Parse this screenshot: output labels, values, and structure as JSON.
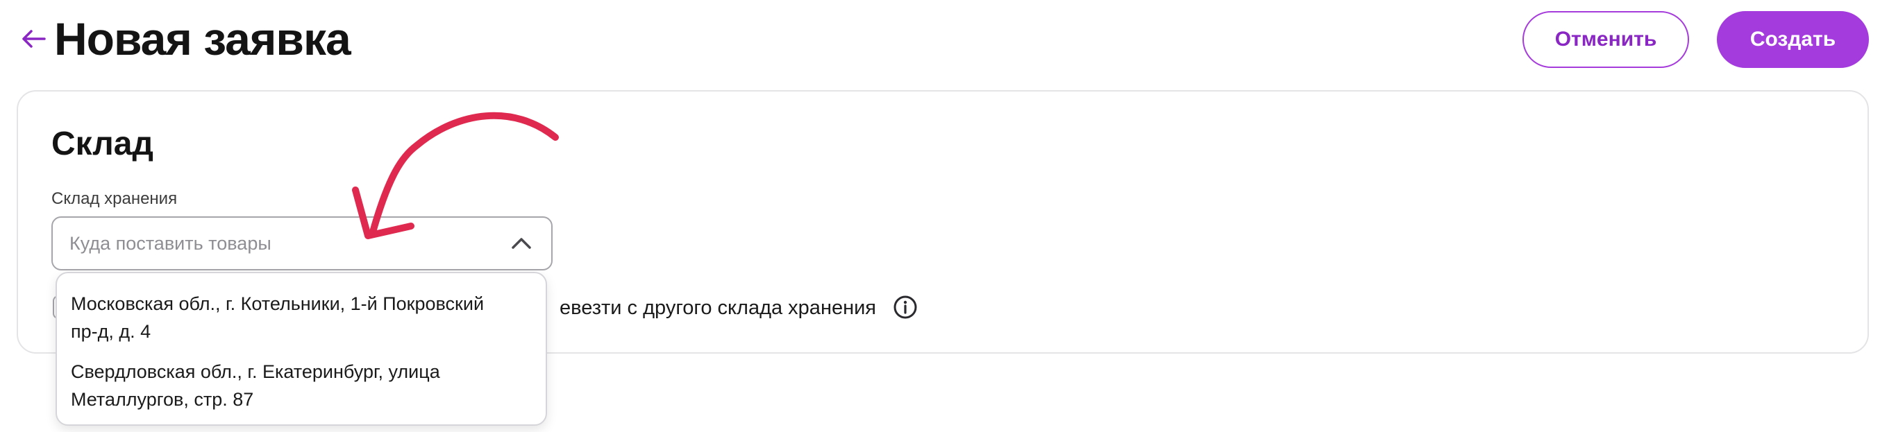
{
  "header": {
    "title": "Новая заявка",
    "cancel_label": "Отменить",
    "create_label": "Создать",
    "accent_color": "#a33bdd"
  },
  "warehouse_section": {
    "title": "Склад",
    "field_label": "Склад хранения",
    "select_placeholder": "Куда поставить товары",
    "checkbox_label_visible_tail": "евезти с другого склада хранения",
    "dropdown_options": [
      {
        "line1": "Московская обл., г. Котельники, 1-й Покровский",
        "line2": "пр-д, д. 4"
      },
      {
        "line1": "Свердловская обл., г. Екатеринбург, улица",
        "line2": "Металлургов, стр. 87"
      }
    ]
  },
  "annotation": {
    "arrow_color": "#e0294f"
  },
  "icons": {
    "back": "arrow-left-icon",
    "chevron": "chevron-up-icon",
    "info": "info-icon"
  }
}
